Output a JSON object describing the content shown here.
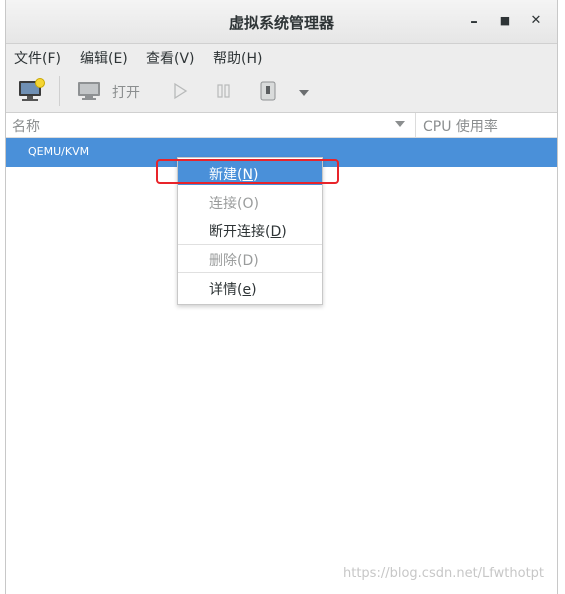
{
  "window": {
    "title": "虚拟系统管理器"
  },
  "window_controls": {
    "minimize": "–",
    "maximize": "■",
    "close": "✕"
  },
  "menubar": {
    "items": [
      {
        "label": "文件(F)"
      },
      {
        "label": "编辑(E)"
      },
      {
        "label": "查看(V)"
      },
      {
        "label": "帮助(H)"
      }
    ]
  },
  "toolbar": {
    "open_label": "打开"
  },
  "list": {
    "columns": {
      "name": "名称",
      "cpu": "CPU 使用率"
    },
    "rows": [
      {
        "label": "QEMU/KVM",
        "selected": true
      }
    ]
  },
  "context_menu": {
    "items": [
      {
        "label": "新建",
        "mnemonic": "N",
        "state": "active"
      },
      {
        "label": "连接",
        "mnemonic": "O",
        "state": "disabled"
      },
      {
        "label": "断开连接",
        "mnemonic": "D",
        "state": "enabled"
      },
      {
        "label": "删除",
        "mnemonic": "D",
        "state": "disabled"
      },
      {
        "label": "详情",
        "mnemonic": "e",
        "state": "enabled"
      }
    ]
  },
  "watermark": "https://blog.csdn.net/Lfwthotpt",
  "colors": {
    "selection": "#4a90d9",
    "highlight_box": "#e8242a"
  }
}
